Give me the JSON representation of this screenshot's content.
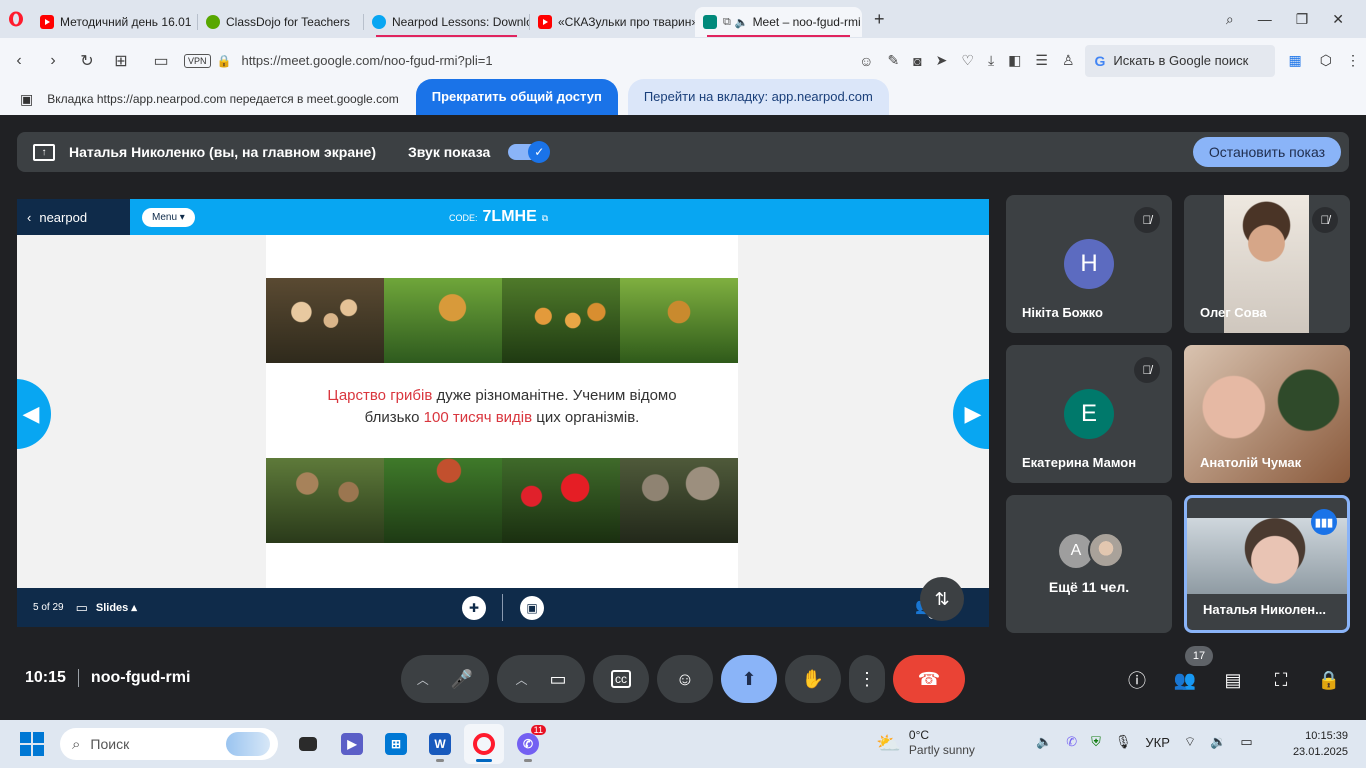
{
  "browser": {
    "tabs": [
      {
        "label": "Методичний день 16.01",
        "icon": "youtube-icon",
        "active": false
      },
      {
        "label": "ClassDojo for Teachers",
        "icon": "classdojo-icon",
        "active": false
      },
      {
        "label": "Nearpod Lessons: Downlo",
        "icon": "nearpod-icon",
        "active": false
      },
      {
        "label": "«СКАЗульки про тварин»",
        "icon": "youtube-icon",
        "active": false
      },
      {
        "label": "Meet – noo-fgud-rmi",
        "icon": "meet-icon",
        "active": true
      }
    ],
    "vpn": "VPN",
    "url": "https://meet.google.com/noo-fgud-rmi?pli=1",
    "search_placeholder": "Искать в Google поиск"
  },
  "share_bar": {
    "message": "Вкладка https://app.nearpod.com передается в meet.google.com",
    "stop_sharing": "Прекратить общий доступ",
    "switch_tab": "Перейти на вкладку: app.nearpod.com"
  },
  "presenter": {
    "name": "Наталья Николенко (вы, на главном экране)",
    "sound_label": "Звук показа",
    "sound_on": true,
    "stop_show": "Остановить показ"
  },
  "nearpod": {
    "logo": "nearpod",
    "menu": "Menu",
    "code_label": "CODE:",
    "code": "7LMHE",
    "slide_text": {
      "part1": "Царство грибів",
      "part2": " дуже різноманітне. Ученим відомо",
      "part3": "близько ",
      "part4": "100 тисяч видів",
      "part5": " цих організмів."
    },
    "page": "5 of 29",
    "slides_label": "Slides",
    "participants_count": "12"
  },
  "participants": [
    {
      "name": "Нікіта Божко",
      "initial": "Н",
      "color": "#5c6bc0",
      "muted": true,
      "video": false
    },
    {
      "name": "Олег Сова",
      "initial": "",
      "muted": true,
      "video": true
    },
    {
      "name": "Екатерина Мамон",
      "initial": "Е",
      "color": "#00796b",
      "muted": true,
      "video": false
    },
    {
      "name": "Анатолій Чумак",
      "initial": "",
      "muted": false,
      "video": true
    },
    {
      "name": "Ещё 11 чел.",
      "initial": "A",
      "color": "#9e9e9e"
    },
    {
      "name": "Наталья Николен...",
      "initial": "",
      "speaking": true,
      "video": true
    }
  ],
  "meet_bar": {
    "time": "10:15",
    "meeting_code": "noo-fgud-rmi",
    "people_count": "17"
  },
  "taskbar": {
    "search": "Поиск",
    "weather_temp": "0°C",
    "weather_desc": "Partly sunny",
    "lang": "УКР",
    "time": "10:15:39",
    "date": "23.01.2025",
    "viber_badge": "11"
  }
}
